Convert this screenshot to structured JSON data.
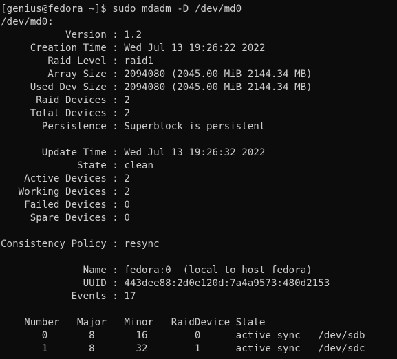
{
  "terminal": {
    "lines": [
      "[genius@fedora ~]$ sudo mdadm -D /dev/md0",
      "/dev/md0:",
      "           Version : 1.2",
      "     Creation Time : Wed Jul 13 19:26:22 2022",
      "        Raid Level : raid1",
      "        Array Size : 2094080 (2045.00 MiB 2144.34 MB)",
      "     Used Dev Size : 2094080 (2045.00 MiB 2144.34 MB)",
      "      Raid Devices : 2",
      "     Total Devices : 2",
      "       Persistence : Superblock is persistent",
      "",
      "       Update Time : Wed Jul 13 19:26:32 2022",
      "             State : clean",
      "    Active Devices : 2",
      "   Working Devices : 2",
      "    Failed Devices : 0",
      "     Spare Devices : 0",
      "",
      "Consistency Policy : resync",
      "",
      "              Name : fedora:0  (local to host fedora)",
      "              UUID : 443dee88:2d0e120d:7a4a9573:480d2153",
      "            Events : 17",
      "",
      "    Number   Major   Minor   RaidDevice State",
      "       0       8       16        0      active sync   /dev/sdb",
      "       1       8       32        1      active sync   /dev/sdc"
    ]
  }
}
